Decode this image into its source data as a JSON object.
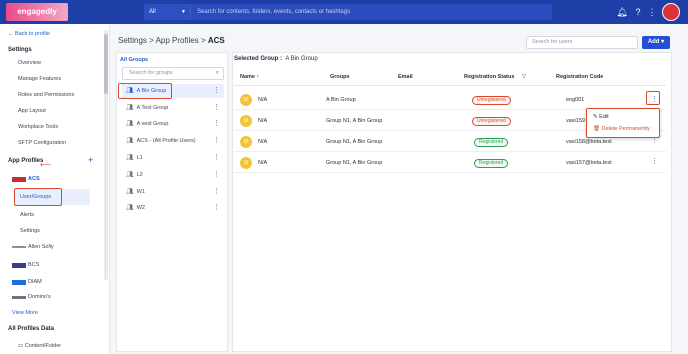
{
  "topbar": {
    "logo": "engagedly",
    "search_scope": "All",
    "search_placeholder": "Search for contents, folders, events, contacts or hashtags",
    "avatar_text": "Avatar"
  },
  "sidebar": {
    "back": "Back to profile",
    "settings_head": "Settings",
    "settings_items": [
      "Overview",
      "Manage Features",
      "Roles and Permissions",
      "App Layout",
      "Workplace Tools",
      "SFTP Configuration"
    ],
    "app_profiles_head": "App Profiles",
    "acs_label": "ACS",
    "acs_sub": [
      "User/Groups",
      "Alerts",
      "Settings"
    ],
    "profiles": [
      "Allen Solly",
      "BCS",
      "DIAM",
      "Domino's"
    ],
    "view_more": "View More",
    "all_profiles_head": "All Profiles Data",
    "content_folder": "Content/Folder"
  },
  "breadcrumb": {
    "part1": "Settings",
    "sep": " > ",
    "part2": "App Profiles",
    "part3": "ACS"
  },
  "users_search_placeholder": "Search for users",
  "add_button": "Add",
  "groups": {
    "title": "All Groups",
    "search_placeholder": "Search for groups",
    "items": [
      "A Bin Group",
      "A Test Group",
      "A vest Group",
      "ACS - (All Profile Users)",
      "L1",
      "L2",
      "W1",
      "W2"
    ]
  },
  "selected_group": {
    "label": "Selected Group :",
    "value": "A Bin Group"
  },
  "table": {
    "headers": [
      "Name",
      "Groups",
      "Email",
      "Registration Status",
      "Registration Code"
    ],
    "rows": [
      {
        "avatar": "U",
        "name": "N/A",
        "groups": "A Bin Group",
        "email": "",
        "status": "Unregistered",
        "code": "eng001"
      },
      {
        "avatar": "U",
        "name": "N/A",
        "groups": "Group N1, A Bin Group",
        "email": "",
        "status": "Unregistered",
        "code": "vasi159"
      },
      {
        "avatar": "U",
        "name": "N/A",
        "groups": "Group N1, A Bin Group",
        "email": "",
        "status": "Registered",
        "code": "vasi158@beta.test"
      },
      {
        "avatar": "U",
        "name": "N/A",
        "groups": "Group N1, A Bin Group",
        "email": "",
        "status": "Registered",
        "code": "vasi157@beta.test"
      }
    ]
  },
  "row_menu": {
    "edit": "Edit",
    "delete": "Delete Permanently"
  },
  "colors": {
    "primary": "#1f3fa8",
    "accent": "#2150d6",
    "highlight_box": "#d64a2a",
    "registered": "#2f9d55",
    "unregistered": "#d64a2a"
  }
}
